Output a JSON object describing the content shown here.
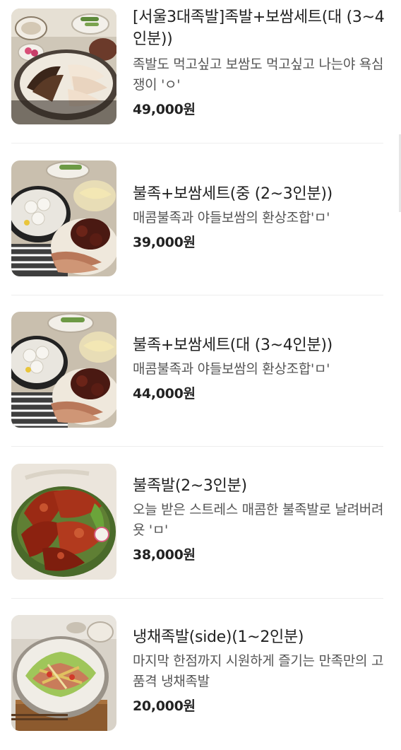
{
  "menu": {
    "items": [
      {
        "name": "[서울3대족발]족발+보쌈세트(대 (3~4인분))",
        "description": "족발도 먹고싶고 보쌈도 먹고싶고 나는야 욕심쟁이 'ㅇ'",
        "price": "49,000원",
        "image_icon": "jokbal-bossam-platter-photo"
      },
      {
        "name": "불족+보쌈세트(중 (2~3인분))",
        "description": "매콤불족과 야들보쌈의 환상조합'ㅁ'",
        "price": "39,000원",
        "image_icon": "buljok-bossam-set-photo"
      },
      {
        "name": "불족+보쌈세트(대 (3~4인분))",
        "description": "매콤불족과 야들보쌈의 환상조합'ㅁ'",
        "price": "44,000원",
        "image_icon": "buljok-bossam-set-photo"
      },
      {
        "name": "불족발(2~3인분)",
        "description": "오늘 받은 스트레스 매콤한 불족발로 날려버려욧 'ㅁ'",
        "price": "38,000원",
        "image_icon": "spicy-jokbal-photo"
      },
      {
        "name": "냉채족발(side)(1~2인분)",
        "description": "마지막 한점까지 시원하게 즐기는 만족만의 고품격 냉채족발",
        "price": "20,000원",
        "image_icon": "cold-jokbal-salad-photo"
      }
    ]
  }
}
